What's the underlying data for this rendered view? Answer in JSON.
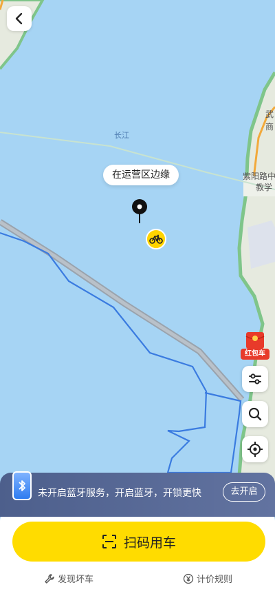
{
  "map": {
    "tooltip": "在运营区边缘",
    "river_label": "长江",
    "road_label": "紫阳路中",
    "poi_label_1": "武",
    "poi_label_2": "商",
    "poi_label_3": "教学",
    "water_color": "#a6d4f4",
    "route_color": "#3a7be0"
  },
  "side": {
    "redpacket_label": "红包车",
    "filter_icon": "sliders-icon",
    "search_icon": "search-icon",
    "locate_icon": "locate-icon"
  },
  "bluetooth_banner": {
    "message": "未开启蓝牙服务，开启蓝牙，开锁更快",
    "action": "去开启"
  },
  "primary": {
    "scan_label": "扫码用车",
    "accent_color": "#ffdc00"
  },
  "bottom_links": {
    "report": "发现坏车",
    "pricing": "计价规则"
  }
}
